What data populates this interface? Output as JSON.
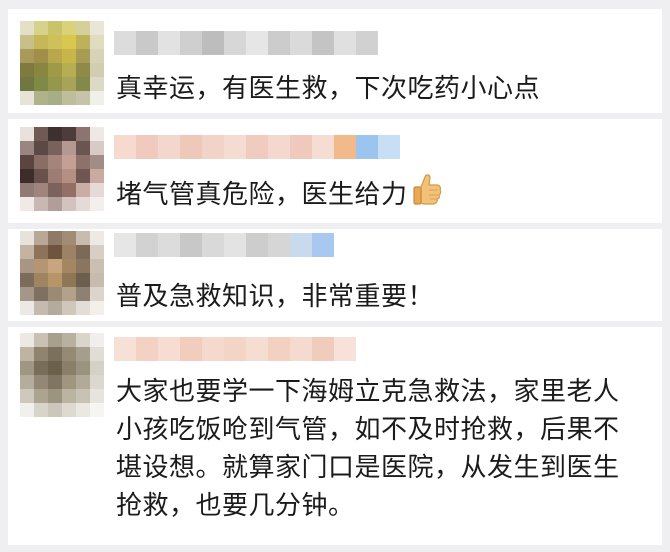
{
  "comments": [
    {
      "text": "真幸运，有医生救，下次吃药小心点",
      "avatar_colors": [
        "#e4e0c8",
        "#d7d28a",
        "#c9c46a",
        "#d9d27a",
        "#d5cf9a",
        "#e9e6d5",
        "#c8c08a",
        "#c6b856",
        "#cfc05a",
        "#d8c84e",
        "#bdb25a",
        "#e0dcc0",
        "#a99a5a",
        "#9f8f48",
        "#b8a74c",
        "#c9b648",
        "#a89b55",
        "#d8d3b8",
        "#7f7a3f",
        "#8a8640",
        "#a09a46",
        "#b7ad52",
        "#8f8a48",
        "#d2cdb0",
        "#6e7840",
        "#7e8a45",
        "#95974c",
        "#a7a457",
        "#838949",
        "#dcd9c6",
        "#e7e4d6",
        "#aeb38a",
        "#a7ad86",
        "#bfbe9b",
        "#c5c3a8",
        "#f0efe8"
      ],
      "name_colors": [
        "#dcdcdc",
        "#c9c9c9",
        "#e2e2e2",
        "#cfcfcf",
        "#bdbdbd",
        "#d7d7d7",
        "#e6e6e6",
        "#cccccc",
        "#dadada",
        "#c4c4c4",
        "#e0e0e0",
        "#d1d1d1"
      ],
      "name_blocks": 12
    },
    {
      "text": "堵气管真危险，医生给力",
      "emoji": "thumbs-up-icon",
      "avatar_colors": [
        "#e9e1dc",
        "#6f5a55",
        "#3e302d",
        "#4d3c39",
        "#8c7570",
        "#efe8e4",
        "#9a8580",
        "#5c4844",
        "#7a625c",
        "#b49993",
        "#6b5550",
        "#d9cac6",
        "#5a4541",
        "#8a6d66",
        "#a5847b",
        "#c39f95",
        "#8d716b",
        "#a38c86",
        "#3d2d2a",
        "#6a524c",
        "#9c7c73",
        "#b58f84",
        "#6f5650",
        "#caa9a0",
        "#8f7a75",
        "#a0857e",
        "#7b625c",
        "#946f65",
        "#c9aea6",
        "#e6dad6",
        "#f0e9e6",
        "#c8b7b2",
        "#b19e99",
        "#d3c3be",
        "#e5dad6",
        "#f4efed"
      ],
      "name_colors": [
        "#f6d9cf",
        "#f0cbbd",
        "#f3d6cc",
        "#eec8b9",
        "#f2d3c7",
        "#f5dcd2",
        "#f0cbc0",
        "#f4d8cd",
        "#efc9bb",
        "#f6ddd4",
        "#f2b98a",
        "#9bc4ee",
        "#c7def6"
      ],
      "name_blocks": 13
    },
    {
      "text": "普及急救知识，非常重要！",
      "avatar_colors": [
        "#e7e2db",
        "#b8a896",
        "#8f7a65",
        "#a18c76",
        "#c9bcae",
        "#ede9e4",
        "#c2b3a2",
        "#8c7359",
        "#6e553f",
        "#9d8265",
        "#7d6a56",
        "#d8cfc4",
        "#a89584",
        "#b59674",
        "#c8a57c",
        "#a58662",
        "#8a7560",
        "#cbbfb1",
        "#7d6b5b",
        "#9f855f",
        "#b89566",
        "#8f7756",
        "#6d5f50",
        "#c6bbad",
        "#a49788",
        "#7f7162",
        "#9a8a76",
        "#b3a18a",
        "#8f8171",
        "#dcd5cc",
        "#ece8e3",
        "#c4baae",
        "#b5aa9c",
        "#d0c7bb",
        "#e2ddd6",
        "#f3f0ec"
      ],
      "name_colors": [
        "#e6e6e6",
        "#d2d2d2",
        "#dcdcdc",
        "#c8c8c8",
        "#d9d9d9",
        "#e3e3e3",
        "#cdcdcd",
        "#d6d6d6",
        "#c9d9ee",
        "#a9c8f0"
      ],
      "name_blocks": 10
    },
    {
      "text": "大家也要学一下海姆立克急救法，家里老人小孩吃饭呛到气管，如不及时抢救，后果不堪设想。就算家门口是医院，从发生到医生抢救，也要几分钟。",
      "avatar_colors": [
        "#ece9e3",
        "#c9c2b4",
        "#a8a08e",
        "#b9b1a0",
        "#dad5cb",
        "#f1efeb",
        "#bdb4a2",
        "#8e8470",
        "#7a705b",
        "#958a73",
        "#a69e8d",
        "#e1ddd5",
        "#9f9684",
        "#776d59",
        "#6a604c",
        "#8a7f68",
        "#9b927f",
        "#d6d1c7",
        "#b5ad9c",
        "#928875",
        "#7f7562",
        "#a0967f",
        "#b2aa99",
        "#dcd8cf",
        "#cfc9bd",
        "#aca390",
        "#9d947f",
        "#bcb4a2",
        "#c8c2b5",
        "#e7e4de",
        "#f2f0ec",
        "#d9d4ca",
        "#cdc7bb",
        "#dfdad1",
        "#ebe8e2",
        "#f6f5f2"
      ],
      "name_colors": [
        "#f7e0d6",
        "#f3d2c4",
        "#f6dcd1",
        "#f1cdbe",
        "#f5d9cd",
        "#f3d5c8",
        "#f6ddd2",
        "#f2d0c2",
        "#f5dacf",
        "#f0ccbd",
        "#f7e1d8"
      ],
      "name_blocks": 11
    }
  ]
}
